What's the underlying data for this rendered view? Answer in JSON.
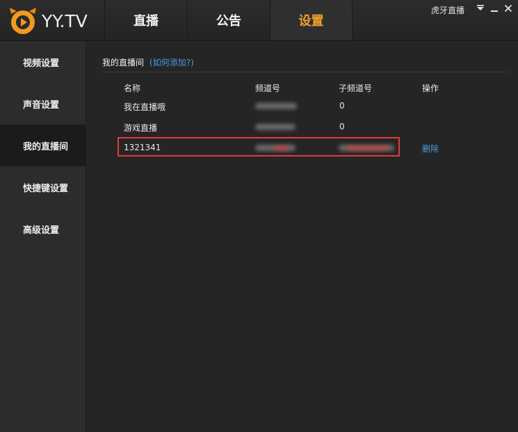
{
  "app": {
    "logo_text": "YY.TV",
    "window_title": "虎牙直播",
    "accent_color": "#f0a22a"
  },
  "nav": {
    "tabs": [
      {
        "label": "直播",
        "active": false
      },
      {
        "label": "公告",
        "active": false
      },
      {
        "label": "设置",
        "active": true
      }
    ]
  },
  "window_controls": [
    "dropdown-icon",
    "minimize-icon",
    "close-icon"
  ],
  "sidebar": {
    "items": [
      {
        "label": "视频设置",
        "active": false
      },
      {
        "label": "声音设置",
        "active": false
      },
      {
        "label": "我的直播间",
        "active": true
      },
      {
        "label": "快捷键设置",
        "active": false
      },
      {
        "label": "高级设置",
        "active": false
      }
    ]
  },
  "content": {
    "section_title": "我的直播间",
    "help_link": "(如何添加?)",
    "table": {
      "headers": [
        "名称",
        "频道号",
        "子频道号",
        "操作"
      ],
      "rows": [
        {
          "name": "我在直播哦",
          "channel": "",
          "sub_channel": "0",
          "action": ""
        },
        {
          "name": "游戏直播",
          "channel": "",
          "sub_channel": "0",
          "action": ""
        },
        {
          "name": "1321341",
          "channel": "",
          "sub_channel": "",
          "action": "删除"
        }
      ]
    }
  }
}
